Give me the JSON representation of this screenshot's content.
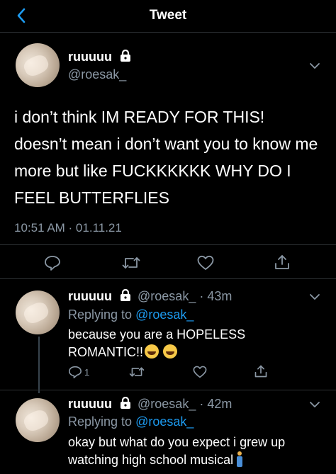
{
  "header": {
    "title": "Tweet",
    "back_icon": "chevron-left-icon"
  },
  "colors": {
    "background": "#000000",
    "accent": "#1d9bf0",
    "muted": "#8b98a5",
    "divider": "#2f3336"
  },
  "main_tweet": {
    "display_name": "ruuuuu",
    "handle": "@roesak_",
    "text": "i don’t think IM READY FOR THIS! doesn’t mean i don’t want you to know me more but like FUCKKKKKK WHY DO I FEEL BUTTERFLIES",
    "timestamp": "10:51 AM · 01.11.21"
  },
  "replies": [
    {
      "display_name": "ruuuuu",
      "handle_time": "@roesak_ · 43m",
      "replying_prefix": "Replying to",
      "replying_to": "@roesak_",
      "text": "because you are a HOPELESS ROMANTIC!!",
      "emoji": "rolling-on-floor-laughing emoji x2",
      "reply_count": "1"
    },
    {
      "display_name": "ruuuuu",
      "handle_time": "@roesak_ · 42m",
      "replying_prefix": "Replying to",
      "replying_to": "@roesak_",
      "text": "okay but what do you expect i grew up watching high school musical",
      "emoji": "person-standing emoji"
    }
  ]
}
